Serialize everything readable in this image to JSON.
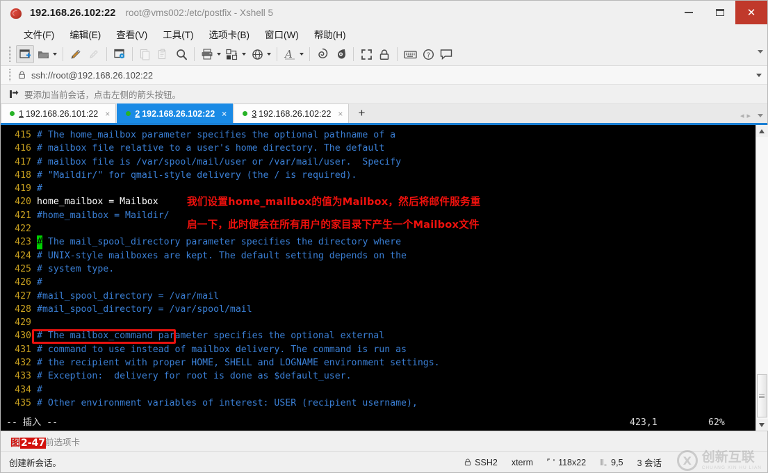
{
  "window": {
    "address_title": "192.168.26.102:22",
    "subtitle": "root@vms002:/etc/postfix - Xshell 5",
    "minimize": "–",
    "maximize": "□",
    "close": "✕"
  },
  "menu": {
    "items": [
      {
        "label": "文件(F)",
        "name": "menu-file"
      },
      {
        "label": "编辑(E)",
        "name": "menu-edit"
      },
      {
        "label": "查看(V)",
        "name": "menu-view"
      },
      {
        "label": "工具(T)",
        "name": "menu-tools"
      },
      {
        "label": "选项卡(B)",
        "name": "menu-tab"
      },
      {
        "label": "窗口(W)",
        "name": "menu-window"
      },
      {
        "label": "帮助(H)",
        "name": "menu-help"
      }
    ]
  },
  "toolbar": {
    "icons": [
      "new-session-icon",
      "open-folder-icon",
      "folder-dropdown-caret",
      "edit-pencil-icon",
      "clear-screen-icon",
      "session-properties-icon",
      "copy-icon",
      "paste-icon",
      "find-icon",
      "print-icon",
      "print-dropdown-caret",
      "transfer-file-icon",
      "transfer-dropdown-caret",
      "globe-icon",
      "globe-dropdown-caret",
      "font-icon",
      "font-dropdown-caret",
      "xftp-icon",
      "xagent-icon",
      "fullscreen-icon",
      "lock-icon",
      "keyboard-icon",
      "help-icon",
      "comment-icon"
    ]
  },
  "address": {
    "lock_icon": "lock-icon",
    "url": "ssh://root@192.168.26.102:22"
  },
  "hint": {
    "icon": "add-to-favorites-icon",
    "text": "要添加当前会话，点击左侧的箭头按钮。"
  },
  "tabs": {
    "items": [
      {
        "num": "1",
        "label": "192.168.26.101:22",
        "active": false,
        "close": "×"
      },
      {
        "num": "2",
        "label": "192.168.26.102:22",
        "active": true,
        "close": "×"
      },
      {
        "num": "3",
        "label": "192.168.26.102:22",
        "active": false,
        "close": "×"
      }
    ],
    "add_label": "+",
    "nav_prev": "◂",
    "nav_next": "▸"
  },
  "terminal": {
    "lines": [
      {
        "num": "415",
        "text": "# The home_mailbox parameter specifies the optional pathname of a",
        "style": "comment"
      },
      {
        "num": "416",
        "text": "# mailbox file relative to a user's home directory. The default",
        "style": "comment"
      },
      {
        "num": "417",
        "text": "# mailbox file is /var/spool/mail/user or /var/mail/user.  Specify",
        "style": "comment"
      },
      {
        "num": "418",
        "text": "# \"Maildir/\" for qmail-style delivery (the / is required).",
        "style": "comment"
      },
      {
        "num": "419",
        "text": "#",
        "style": "comment"
      },
      {
        "num": "420",
        "text": "home_mailbox = Mailbox",
        "style": "boxed"
      },
      {
        "num": "421",
        "text": "#home_mailbox = Maildir/",
        "style": "comment"
      },
      {
        "num": "422",
        "text": "",
        "style": "comment"
      },
      {
        "num": "423",
        "text": "# The mail_spool_directory parameter specifies the directory where",
        "style": "cursor"
      },
      {
        "num": "424",
        "text": "# UNIX-style mailboxes are kept. The default setting depends on the",
        "style": "comment"
      },
      {
        "num": "425",
        "text": "# system type.",
        "style": "comment"
      },
      {
        "num": "426",
        "text": "#",
        "style": "comment"
      },
      {
        "num": "427",
        "text": "#mail_spool_directory = /var/mail",
        "style": "comment"
      },
      {
        "num": "428",
        "text": "#mail_spool_directory = /var/spool/mail",
        "style": "comment"
      },
      {
        "num": "429",
        "text": "",
        "style": "comment"
      },
      {
        "num": "430",
        "text": "# The mailbox_command parameter specifies the optional external",
        "style": "comment"
      },
      {
        "num": "431",
        "text": "# command to use instead of mailbox delivery. The command is run as",
        "style": "comment"
      },
      {
        "num": "432",
        "text": "# the recipient with proper HOME, SHELL and LOGNAME environment settings.",
        "style": "comment"
      },
      {
        "num": "433",
        "text": "# Exception:  delivery for root is done as $default_user.",
        "style": "comment"
      },
      {
        "num": "434",
        "text": "#",
        "style": "comment"
      },
      {
        "num": "435",
        "text": "# Other environment variables of interest: USER (recipient username),",
        "style": "comment"
      }
    ],
    "annotations": [
      "我们设置home_mailbox的值为Mailbox，然后将邮件服务重",
      "启一下，此时便会在所有用户的家目录下产生一个Mailbox文件"
    ],
    "vim_status": {
      "mode": "-- 插入 --",
      "position": "423,1",
      "percent": "62%"
    },
    "colors": {
      "background": "#000000",
      "comment": "#3a7fd5",
      "line_number": "#c8a020",
      "highlight_box": "#e8120e",
      "cursor": "#00d000",
      "annotation": "#f0110d"
    }
  },
  "sendbar": {
    "text": "发送到当前选项卡",
    "figure_caption": "图2-47"
  },
  "statusbar": {
    "left": "创建新会话。",
    "protocol": "SSH2",
    "term_type": "xterm",
    "size": "118x22",
    "cursor_pos": "9,5",
    "sessions": "3 会话"
  },
  "watermark": {
    "mark": "X",
    "cn": "创新互联",
    "en": "CHUANG XIN HU LIAN"
  }
}
